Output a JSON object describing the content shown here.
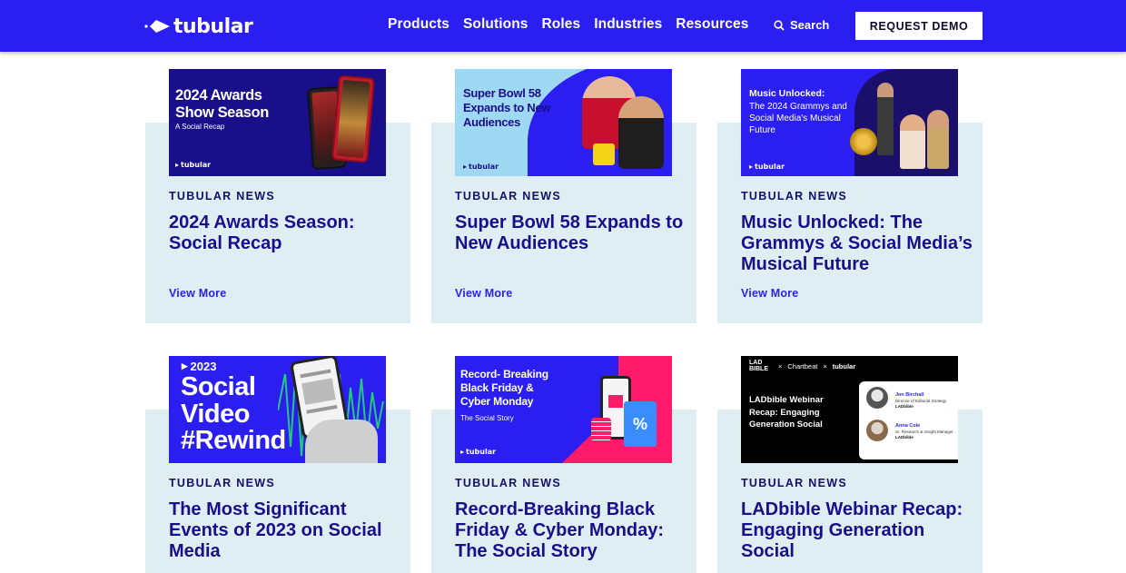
{
  "header": {
    "logo_text": "tubular",
    "nav": [
      "Products",
      "Solutions",
      "Roles",
      "Industries",
      "Resources"
    ],
    "search_label": "Search",
    "demo_button": "REQUEST DEMO"
  },
  "cards": [
    {
      "kicker": "TUBULAR NEWS",
      "title": "2024 Awards Season: Social Recap",
      "link": "View More",
      "thumb": {
        "headline": "2024 Awards Show Season",
        "sub": "A Social Recap",
        "logo": "tubular",
        "bg": "#1a0f8a"
      }
    },
    {
      "kicker": "TUBULAR NEWS",
      "title": "Super Bowl 58 Expands to New Audiences",
      "link": "View More",
      "thumb": {
        "headline": "Super Bowl 58 Expands to New Audiences",
        "logo": "tubular",
        "bg": "#9fd8f2"
      }
    },
    {
      "kicker": "TUBULAR NEWS",
      "title": "Music Unlocked: The Grammys & Social Media’s Musical Future",
      "link": "View More",
      "thumb": {
        "headline": "Music Unlocked:",
        "sub": "The 2024 Grammys and Social Media's Musical Future",
        "logo": "tubular",
        "bg": "#2a1ff0"
      }
    },
    {
      "kicker": "TUBULAR NEWS",
      "title": "The Most Significant Events of 2023 on Social Media",
      "link": "",
      "thumb": {
        "year": "2023",
        "headline": "Social Video #Rewind",
        "bg": "#2a1ff0"
      }
    },
    {
      "kicker": "TUBULAR NEWS",
      "title": "Record-Breaking Black Friday & Cyber Monday: The Social Story",
      "link": "",
      "thumb": {
        "headline": "Record- Breaking Black Friday & Cyber Monday",
        "sub": "The Social Story",
        "logo": "tubular",
        "percent": "%",
        "bg": "#2a1ff0"
      }
    },
    {
      "kicker": "TUBULAR NEWS",
      "title": "LADbible Webinar Recap: Engaging Generation Social",
      "link": "",
      "thumb": {
        "brands": [
          "LAD BIBLE",
          "Chartbeat",
          "tubular"
        ],
        "headline": "LADbible Webinar Recap: Engaging Generation Social",
        "speakers": [
          {
            "name": "Jon Birchall",
            "role": "Director of Editorial Strategy",
            "org": "LADbible"
          },
          {
            "name": "Anna Cole",
            "role": "Sr. Research & Insight Manager",
            "org": "LADbible"
          }
        ],
        "bg": "#000000"
      }
    }
  ]
}
